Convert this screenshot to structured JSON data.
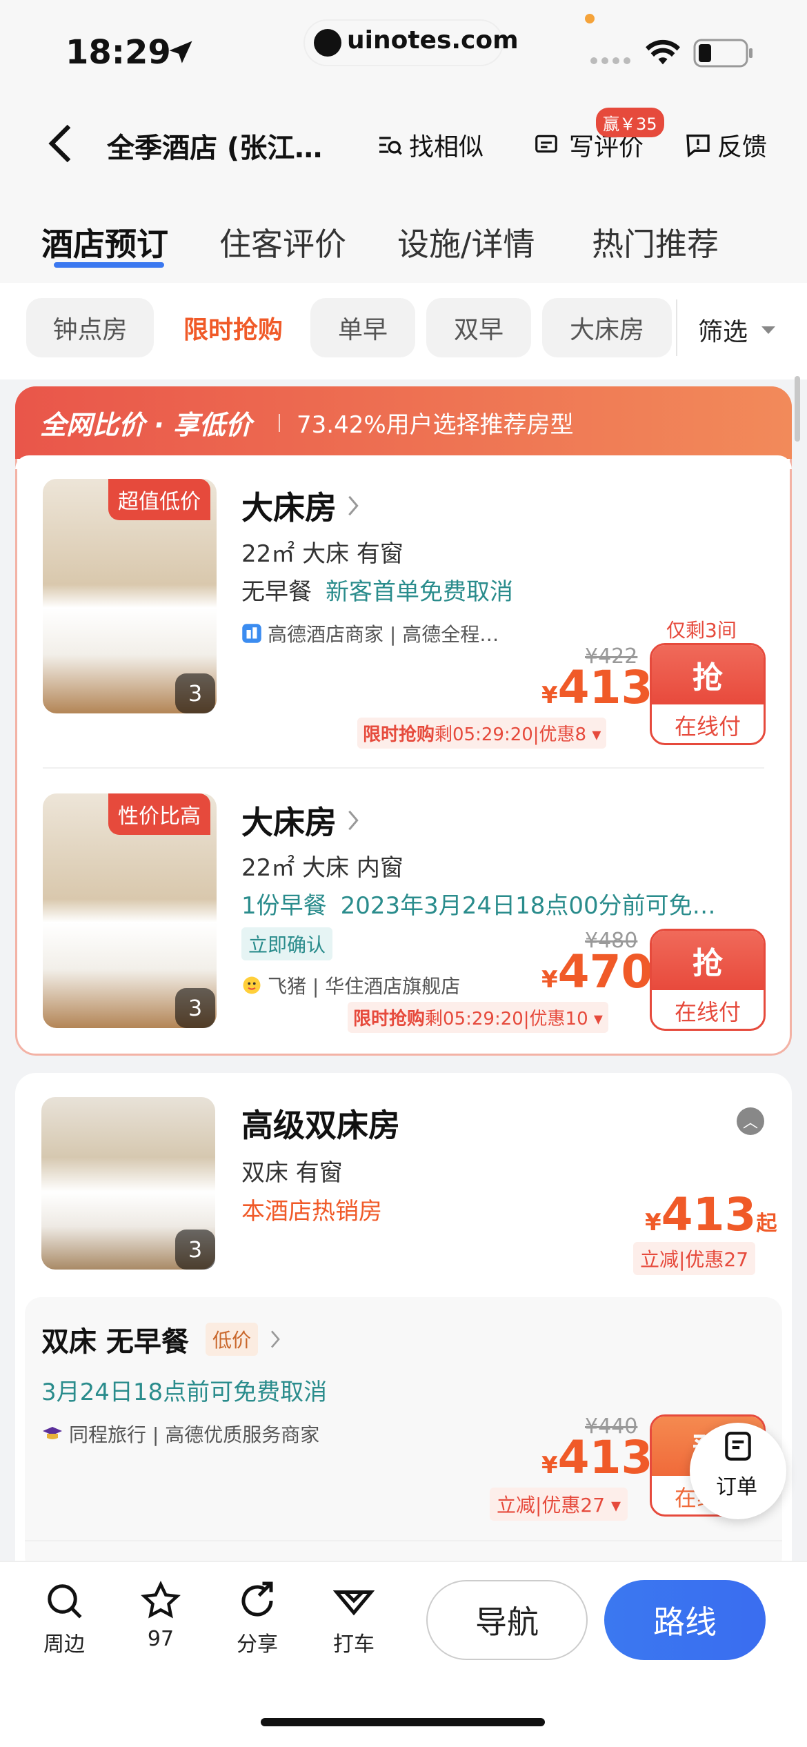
{
  "status_bar": {
    "time": "18:29",
    "url": "uinotes.com"
  },
  "header": {
    "title": "全季酒店 (张江…",
    "find_similar": "找相似",
    "write_review": "写评价",
    "review_badge": "赢￥35",
    "feedback": "反馈"
  },
  "tabs": [
    "酒店预订",
    "住客评价",
    "设施/详情",
    "热门推荐"
  ],
  "chips": [
    "钟点房",
    "限时抢购",
    "单早",
    "双早",
    "大床房"
  ],
  "filter": "筛选",
  "promo": {
    "title": "全网比价 · 享低价",
    "subtitle": "73.42%用户选择推荐房型",
    "rooms": [
      {
        "tag": "超值低价",
        "img_count": "3",
        "name": "大床房",
        "specs": "22㎡  大床  有窗",
        "meal": "无早餐",
        "policy": "新客首单免费取消",
        "source": "高德酒店商家 | 高德全程…",
        "remaining": "仅剩3间",
        "orig_price": "¥422",
        "currency": "¥",
        "price": "413",
        "flash_label": "限时抢购",
        "flash_rest": "剩05:29:20|优惠8",
        "btn_top": "抢",
        "btn_bottom": "在线付"
      },
      {
        "tag": "性价比高",
        "img_count": "3",
        "name": "大床房",
        "specs": "22㎡  大床  内窗",
        "meal": "1份早餐",
        "policy": "2023年3月24日18点00分前可免…",
        "confirm": "立即确认",
        "source": "飞猪 | 华住酒店旗舰店",
        "orig_price": "¥480",
        "currency": "¥",
        "price": "470",
        "flash_label": "限时抢购",
        "flash_rest": "剩05:29:20|优惠10",
        "btn_top": "抢",
        "btn_bottom": "在线付"
      }
    ]
  },
  "room_type": {
    "name": "高级双床房",
    "img_count": "3",
    "specs": "双床  有窗",
    "hot": "本酒店热销房",
    "currency": "¥",
    "price": "413",
    "qi": "起",
    "discount": "立减|优惠27",
    "offer": {
      "title": "双床  无早餐",
      "low_tag": "低价",
      "policy": "3月24日18点前可免费取消",
      "source": "同程旅行 | 高德优质服务商家",
      "orig_price": "¥440",
      "currency": "¥",
      "price": "413",
      "discount": "立减|优惠27",
      "btn_top": "预",
      "btn_bottom": "在线付"
    }
  },
  "float_order": "订单",
  "bottom_nav": {
    "nearby": "周边",
    "favorites": "97",
    "share": "分享",
    "taxi": "打车",
    "navigate": "导航",
    "route": "路线"
  },
  "colors": {
    "accent": "#f05a28",
    "brand_blue": "#3b78f0",
    "red": "#e64a3c",
    "teal": "#2a8c8c"
  }
}
